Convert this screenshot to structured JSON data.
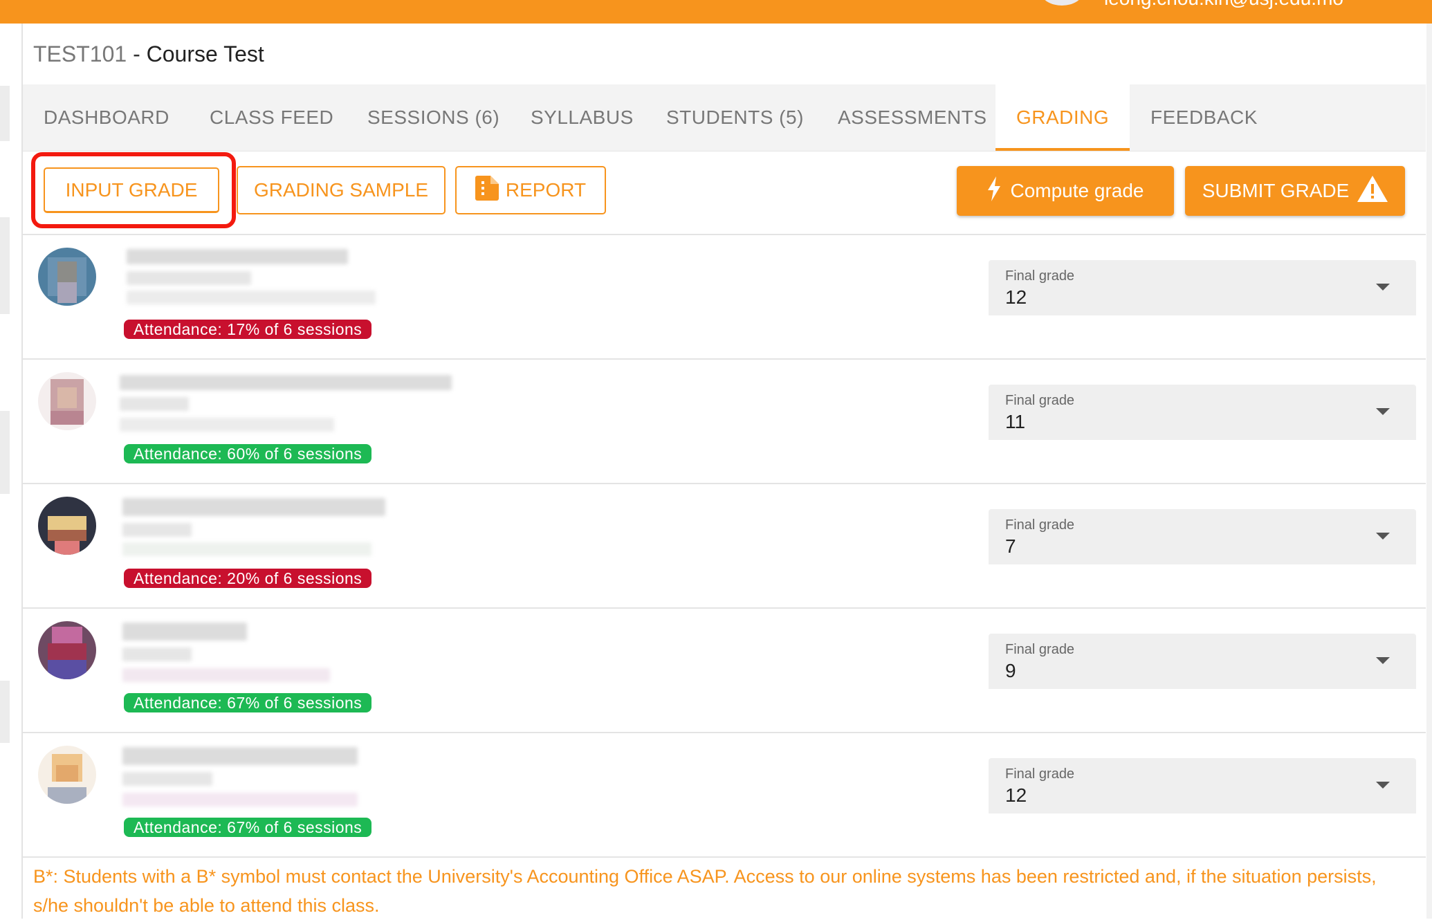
{
  "header": {
    "user_email": "leong.chou.kin@usj.edu.mo"
  },
  "course": {
    "code": "TEST101",
    "separator": " - ",
    "name": "Course Test"
  },
  "tabs": [
    {
      "label": "DASHBOARD",
      "active": false
    },
    {
      "label": "CLASS FEED",
      "active": false
    },
    {
      "label": "SESSIONS (6)",
      "active": false
    },
    {
      "label": "SYLLABUS",
      "active": false
    },
    {
      "label": "STUDENTS (5)",
      "active": false
    },
    {
      "label": "ASSESSMENTS",
      "active": false
    },
    {
      "label": "GRADING",
      "active": true
    },
    {
      "label": "FEEDBACK",
      "active": false
    }
  ],
  "actions": {
    "input_grade": "INPUT GRADE",
    "grading_sample": "GRADING SAMPLE",
    "report": "REPORT",
    "compute_grade": "Compute grade",
    "submit_grade": "SUBMIT GRADE"
  },
  "students": [
    {
      "attendance": "Attendance: 17% of 6 sessions",
      "attendance_status": "low",
      "grade_label": "Final grade",
      "grade": "12"
    },
    {
      "attendance": "Attendance: 60% of 6 sessions",
      "attendance_status": "ok",
      "grade_label": "Final grade",
      "grade": "11"
    },
    {
      "attendance": "Attendance: 20% of 6 sessions",
      "attendance_status": "low",
      "grade_label": "Final grade",
      "grade": "7"
    },
    {
      "attendance": "Attendance: 67% of 6 sessions",
      "attendance_status": "ok",
      "grade_label": "Final grade",
      "grade": "9"
    },
    {
      "attendance": "Attendance: 67% of 6 sessions",
      "attendance_status": "ok",
      "grade_label": "Final grade",
      "grade": "12"
    }
  ],
  "footnote": "B*: Students with a B* symbol must contact the University's Accounting Office ASAP. Access to our online systems has been restricted and, if the situation persists, s/he shouldn't be able to attend this class.",
  "colors": {
    "accent": "#f7941d",
    "attendance_low": "#c8102e",
    "attendance_ok": "#1db954",
    "highlight": "#f31a0f"
  },
  "icons": {
    "report": "document-icon",
    "compute": "lightning-bolt-icon",
    "submit": "warning-triangle-icon",
    "dropdown": "caret-down-icon"
  }
}
